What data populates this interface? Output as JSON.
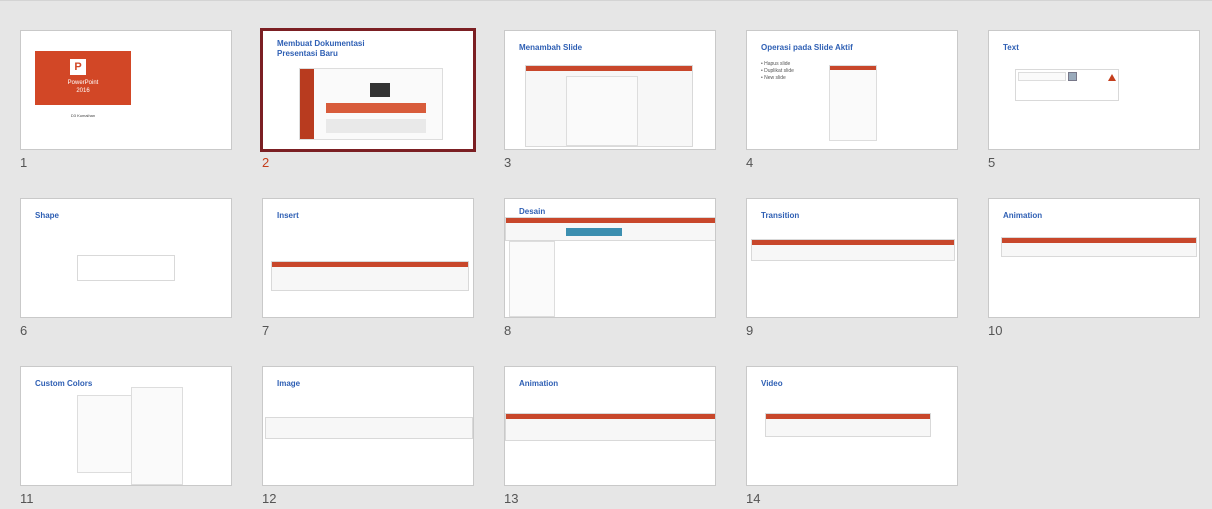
{
  "slides": [
    {
      "num": "1",
      "title": "",
      "app_name": "PowerPoint",
      "app_year": "2016",
      "byline": "D3 Kumaihan"
    },
    {
      "num": "2",
      "title": "Membuat Dokumentasi",
      "title2": "Presentasi Baru"
    },
    {
      "num": "3",
      "title": "Menambah Slide"
    },
    {
      "num": "4",
      "title": "Operasi pada Slide Aktif",
      "bullets": [
        "• Hapus slide",
        "• Duplikat slide",
        "• New slide"
      ]
    },
    {
      "num": "5",
      "title": "Text"
    },
    {
      "num": "6",
      "title": "Shape"
    },
    {
      "num": "7",
      "title": "Insert"
    },
    {
      "num": "8",
      "title": "Desain"
    },
    {
      "num": "9",
      "title": "Transition"
    },
    {
      "num": "10",
      "title": "Animation"
    },
    {
      "num": "11",
      "title": "Custom Colors"
    },
    {
      "num": "12",
      "title": "Image"
    },
    {
      "num": "13",
      "title": "Animation"
    },
    {
      "num": "14",
      "title": "Video"
    }
  ],
  "selected_slide": "2",
  "colors": {
    "accent": "#c43e1c",
    "title": "#2e5fb4",
    "selection_border": "#7b1f23",
    "background": "#e6e6e6"
  }
}
